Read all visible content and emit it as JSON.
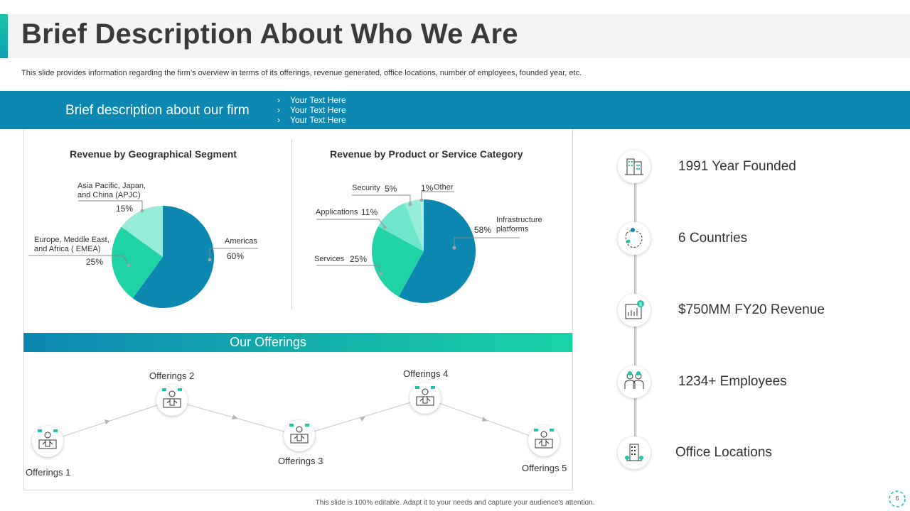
{
  "title": "Brief Description About Who We Are",
  "subtitle": "This slide provides information regarding the firm’s overview in terms of its offerings, revenue generated, office locations, number of employees, founded year, etc.",
  "banner": {
    "title": "Brief description about our firm",
    "bullets": [
      "Your Text Here",
      "Your Text Here",
      "Your Text Here"
    ],
    "bullet_glyph": "›"
  },
  "colors": {
    "dark": "#0b87b0",
    "mid": "#1fd3a6",
    "light": "#97ecd9",
    "lighter": "#b8f1e4",
    "accent": "#1ac5a8"
  },
  "chart_data": [
    {
      "type": "pie",
      "title": "Revenue by Geographical Segment",
      "slices": [
        {
          "label": "Americas",
          "value": 60,
          "display": "60%"
        },
        {
          "label": "Europe, Meddle East, and Africa ( EMEA)",
          "label_lines": [
            "Europe, Meddle East,",
            "and Africa ( EMEA)"
          ],
          "value": 25,
          "display": "25%"
        },
        {
          "label": "Asia Pacific, Japan, and China (APJC)",
          "label_lines": [
            "Asia Pacific, Japan,",
            "and China (APJC)"
          ],
          "value": 15,
          "display": "15%"
        }
      ]
    },
    {
      "type": "pie",
      "title": "Revenue by Product or Service Category",
      "slices": [
        {
          "label": "Infrastructure platforms",
          "label_lines": [
            "Infrastructure",
            "platforms"
          ],
          "value": 58,
          "display": "58%"
        },
        {
          "label": "Services",
          "value": 25,
          "display": "25%"
        },
        {
          "label": "Applications",
          "value": 11,
          "display": "11%"
        },
        {
          "label": "Security",
          "value": 5,
          "display": "5%"
        },
        {
          "label": "Other",
          "value": 1,
          "display": "1%"
        }
      ]
    }
  ],
  "offerings": {
    "title": "Our Offerings",
    "items": [
      "Offerings  1",
      "Offerings  2",
      "Offerings  3",
      "Offerings  4",
      "Offerings  5"
    ]
  },
  "stats": [
    {
      "text": "1991 Year Founded",
      "icon": "building-icon"
    },
    {
      "text": "6 Countries",
      "icon": "map-icon"
    },
    {
      "text": "$750MM FY20 Revenue",
      "icon": "revenue-chart-icon"
    },
    {
      "text": "1234+ Employees",
      "icon": "employees-icon"
    },
    {
      "text": "Office Locations",
      "icon": "office-building-icon"
    }
  ],
  "footer": "This slide is 100% editable.  Adapt it to your needs and capture your audience's attention.",
  "page_number": "6"
}
